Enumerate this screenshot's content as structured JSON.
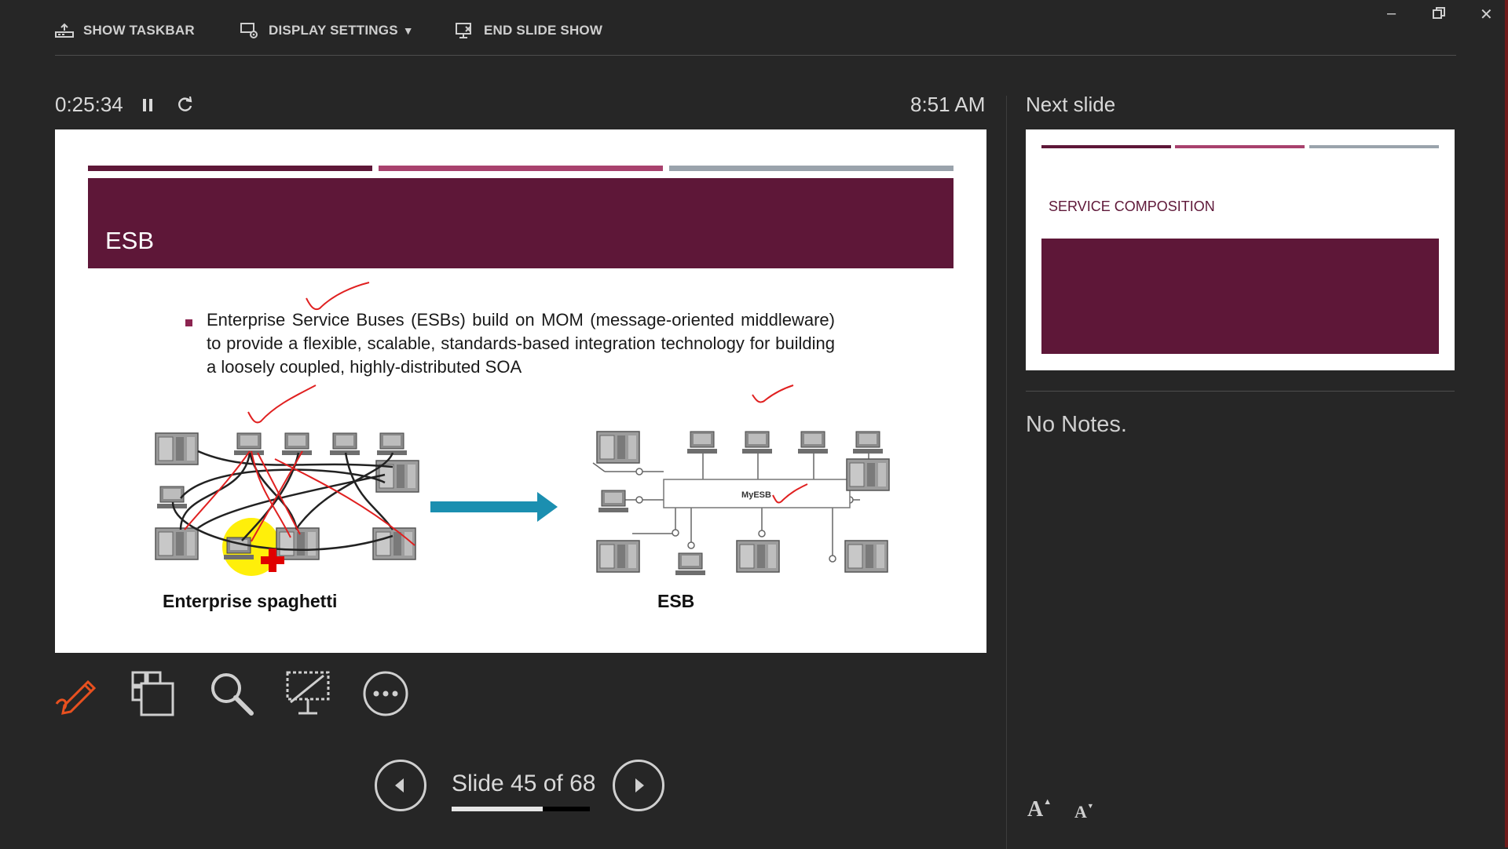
{
  "toolbar": {
    "show_taskbar": "SHOW TASKBAR",
    "display_settings": "DISPLAY SETTINGS",
    "end_slide_show": "END SLIDE SHOW"
  },
  "timer": {
    "elapsed": "0:25:34",
    "clock": "8:51 AM"
  },
  "slide": {
    "title": "ESB",
    "bullet": "Enterprise Service Buses (ESBs) build on MOM (message-oriented middleware) to provide a flexible, scalable, standards-based integration technology for building a loosely coupled, highly-distributed SOA",
    "caption_left": "Enterprise spaghetti",
    "caption_right": "ESB",
    "bus_label": "MyESB",
    "colors": {
      "title_bg": "#5e1738",
      "bar1": "#5e1738",
      "bar2": "#a8416d",
      "bar3": "#9aa3ac",
      "arrow": "#1b8fb0"
    }
  },
  "next": {
    "label": "Next slide",
    "title": "SERVICE COMPOSITION",
    "notes": "No Notes."
  },
  "tools": [
    "pen-tool",
    "see-all-slides",
    "zoom",
    "black-screen",
    "more-options"
  ],
  "nav": {
    "slide_counter": "Slide 45 of 68",
    "progress": 0.66
  },
  "font_controls": {
    "increase": "A",
    "decrease": "A"
  }
}
